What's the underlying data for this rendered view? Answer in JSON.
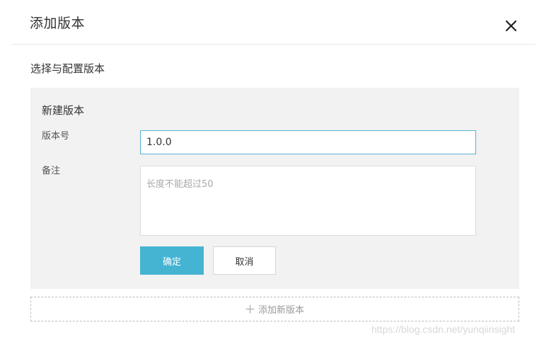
{
  "dialog": {
    "title": "添加版本",
    "close_icon": "close-icon"
  },
  "section": {
    "title": "选择与配置版本"
  },
  "form": {
    "panel_title": "新建版本",
    "version_label": "版本号",
    "version_value": "1.0.0",
    "remark_label": "备注",
    "remark_placeholder": "长度不能超过50",
    "confirm_label": "确定",
    "cancel_label": "取消"
  },
  "add_version": {
    "label": "添加新版本",
    "icon": "plus-icon"
  },
  "watermark": {
    "text": "https://blog.csdn.net/yunqiinsight"
  },
  "colors": {
    "primary": "#45b4d3",
    "input_focus_border": "#56b3d6",
    "panel_background": "#f2f2f2"
  }
}
